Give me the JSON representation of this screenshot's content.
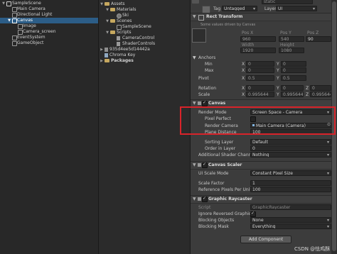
{
  "hierarchy": {
    "items": [
      {
        "label": "SampleScene",
        "kind": "scene",
        "expanded": true
      },
      {
        "label": "Main Camera",
        "kind": "object"
      },
      {
        "label": "Directional Light",
        "kind": "object"
      },
      {
        "label": "Canvas",
        "kind": "object",
        "expanded": true,
        "selected": true
      },
      {
        "label": "Image",
        "kind": "object"
      },
      {
        "label": "Camera_screen",
        "kind": "object"
      },
      {
        "label": "EventSystem",
        "kind": "object"
      },
      {
        "label": "GameObject",
        "kind": "object"
      }
    ]
  },
  "project": {
    "items": [
      {
        "label": "Assets",
        "kind": "folder"
      },
      {
        "label": "Materials",
        "kind": "folder"
      },
      {
        "label": "Ski",
        "kind": "material"
      },
      {
        "label": "Scenes",
        "kind": "folder"
      },
      {
        "label": "SampleScene",
        "kind": "scene"
      },
      {
        "label": "Scripts",
        "kind": "folder"
      },
      {
        "label": "CameraControl",
        "kind": "script"
      },
      {
        "label": "ShaderControls",
        "kind": "script"
      },
      {
        "label": "935d4ee5d14442a",
        "kind": "file"
      },
      {
        "label": "Chroma Key",
        "kind": "shader"
      },
      {
        "label": "Packages",
        "kind": "folder"
      }
    ]
  },
  "inspector": {
    "top": {
      "static_value": "static",
      "tag_label": "Tag",
      "tag_value": "Untagged",
      "layer_label": "Layer",
      "layer_value": "UI"
    },
    "rect_transform": {
      "title": "Rect Transform",
      "note": "Some values driven by Canvas",
      "pos_x_label": "Pos X",
      "pos_y_label": "Pos Y",
      "pos_z_label": "Pos Z",
      "pos_x": "960",
      "pos_y": "540",
      "pos_z": "90",
      "width_label": "Width",
      "height_label": "Height",
      "width": "1920",
      "height": "1080",
      "anchors_label": "Anchors",
      "min_label": "Min",
      "max_label": "Max",
      "pivot_label": "Pivot",
      "rotation_label": "Rotation",
      "scale_label": "Scale",
      "x": "X",
      "y": "Y",
      "z": "Z",
      "min_x": "0",
      "min_y": "0",
      "max_x": "0",
      "max_y": "0",
      "pivot_x": "0.5",
      "pivot_y": "0.5",
      "rot_x": "0",
      "rot_y": "0",
      "rot_z": "0",
      "scale_x": "0.995644",
      "scale_y": "0.995644",
      "scale_z": "0.995644"
    },
    "canvas": {
      "title": "Canvas",
      "render_mode_label": "Render Mode",
      "render_mode": "Screen Space - Camera",
      "pixel_perfect_label": "Pixel Perfect",
      "render_camera_label": "Render Camera",
      "render_camera": "Main Camera (Camera)",
      "plane_distance_label": "Plane Distance",
      "plane_distance": "100",
      "sorting_layer_label": "Sorting Layer",
      "sorting_layer": "Default",
      "order_in_layer_label": "Order in Layer",
      "order_in_layer": "0",
      "shader_channels_label": "Additional Shader Channels",
      "shader_channels": "Nothing"
    },
    "canvas_scaler": {
      "title": "Canvas Scaler",
      "ui_scale_mode_label": "UI Scale Mode",
      "ui_scale_mode": "Constant Pixel Size",
      "scale_factor_label": "Scale Factor",
      "scale_factor": "1",
      "ref_ppu_label": "Reference Pixels Per Unit",
      "ref_ppu": "100"
    },
    "raycaster": {
      "title": "Graphic Raycaster",
      "script_label": "Script",
      "script": "GraphicRaycaster",
      "ignore_reversed_label": "Ignore Reversed Graphics",
      "blocking_objects_label": "Blocking Objects",
      "blocking_objects": "None",
      "blocking_mask_label": "Blocking Mask",
      "blocking_mask": "Everything"
    },
    "add_component": "Add Component"
  },
  "watermark": "CSDN @怯鸡酥",
  "colors": {
    "selection": "#2c5d87",
    "highlight_box": "#d9232a",
    "panel": "#3c3c3c"
  }
}
